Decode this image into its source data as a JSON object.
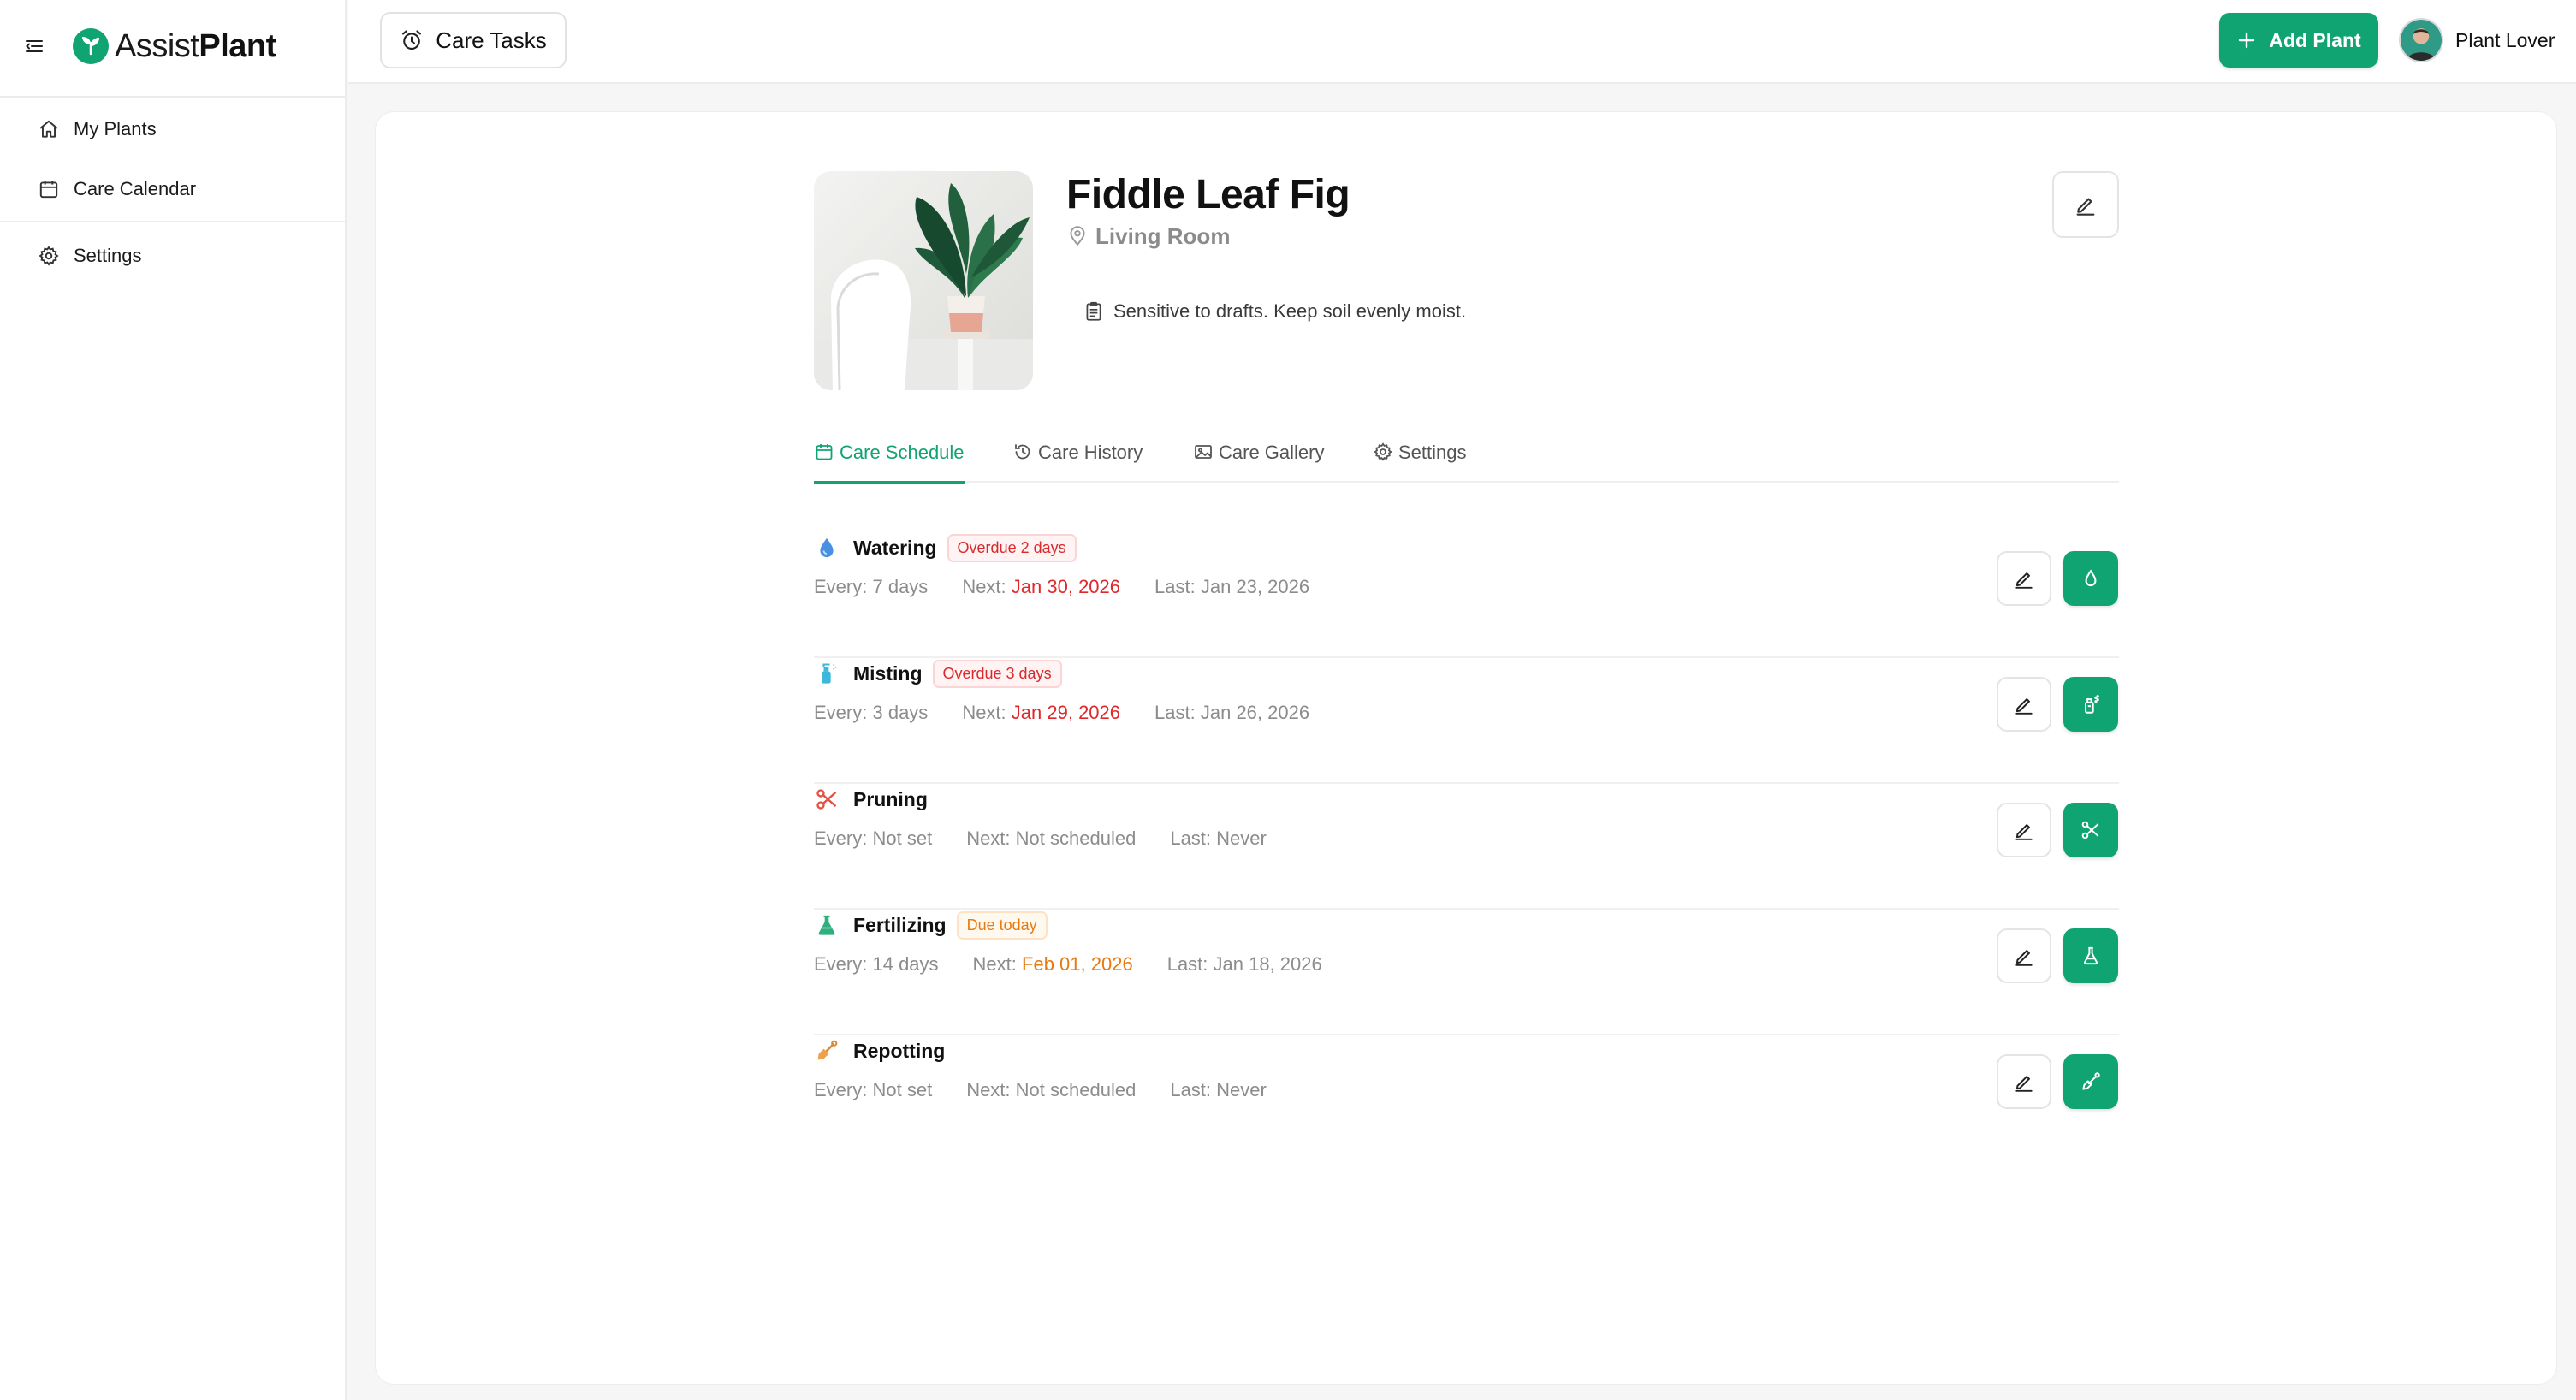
{
  "app": {
    "brand_left": "Assist",
    "brand_right": "Plant",
    "accent_color": "#10a472"
  },
  "sidebar": {
    "items": [
      {
        "label": "My Plants",
        "icon": "home-icon"
      },
      {
        "label": "Care Calendar",
        "icon": "calendar-icon"
      },
      {
        "label": "Settings",
        "icon": "gear-icon"
      }
    ]
  },
  "topbar": {
    "care_tasks_label": "Care Tasks",
    "add_plant_label": "Add Plant",
    "user_name": "Plant Lover"
  },
  "plant": {
    "name": "Fiddle Leaf Fig",
    "location": "Living Room",
    "note": "Sensitive to drafts. Keep soil evenly moist."
  },
  "tabs": [
    {
      "label": "Care Schedule",
      "icon": "calendar-icon",
      "active": true
    },
    {
      "label": "Care History",
      "icon": "history-icon",
      "active": false
    },
    {
      "label": "Care Gallery",
      "icon": "image-icon",
      "active": false
    },
    {
      "label": "Settings",
      "icon": "gear-icon",
      "active": false
    }
  ],
  "schedule": [
    {
      "name": "Watering",
      "badge": "Overdue 2 days",
      "badge_type": "red",
      "every_label": "Every:",
      "every": "7 days",
      "next_label": "Next:",
      "next": "Jan 30, 2026",
      "next_color": "red",
      "last_label": "Last:",
      "last": "Jan 23, 2026",
      "icon": "water-drop-icon"
    },
    {
      "name": "Misting",
      "badge": "Overdue 3 days",
      "badge_type": "red",
      "every_label": "Every:",
      "every": "3 days",
      "next_label": "Next:",
      "next": "Jan 29, 2026",
      "next_color": "red",
      "last_label": "Last:",
      "last": "Jan 26, 2026",
      "icon": "spray-bottle-icon"
    },
    {
      "name": "Pruning",
      "badge": "",
      "badge_type": "",
      "every_label": "Every:",
      "every": "Not set",
      "next_label": "Next:",
      "next": "Not scheduled",
      "next_color": "",
      "last_label": "Last:",
      "last": "Never",
      "icon": "scissors-icon"
    },
    {
      "name": "Fertilizing",
      "badge": "Due today",
      "badge_type": "orange",
      "every_label": "Every:",
      "every": "14 days",
      "next_label": "Next:",
      "next": "Feb 01, 2026",
      "next_color": "orange",
      "last_label": "Last:",
      "last": "Jan 18, 2026",
      "icon": "flask-icon"
    },
    {
      "name": "Repotting",
      "badge": "",
      "badge_type": "",
      "every_label": "Every:",
      "every": "Not set",
      "next_label": "Next:",
      "next": "Not scheduled",
      "next_color": "",
      "last_label": "Last:",
      "last": "Never",
      "icon": "shovel-icon"
    }
  ]
}
